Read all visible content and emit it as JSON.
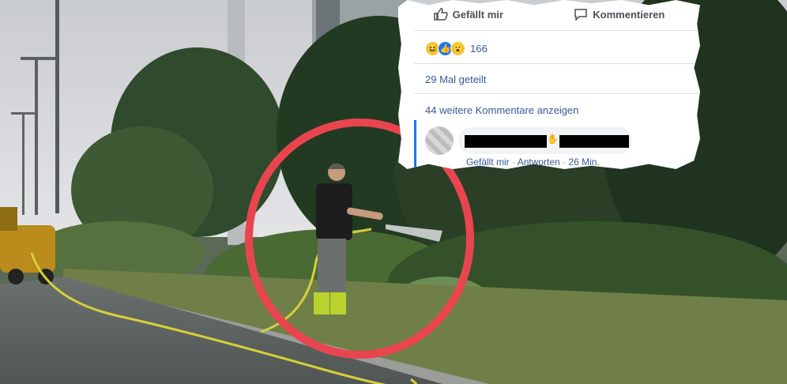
{
  "photo": {
    "description_icons": [
      "tree-icon",
      "lamp-post-icon",
      "hose-icon"
    ],
    "highlight_color": "#e8454f"
  },
  "fb_card": {
    "actions": {
      "like_label": "Gefällt mir",
      "comment_label": "Kommentieren"
    },
    "reactions": {
      "icons": [
        "haha-icon",
        "like-icon",
        "wow-icon"
      ],
      "count": "166"
    },
    "shares": "29 Mal geteilt",
    "more_comments": "44 weitere Kommentare anzeigen",
    "comment": {
      "like": "Gefällt mir",
      "sep1": "·",
      "reply": "Antworten",
      "sep2": "·",
      "time": "26 Min."
    }
  }
}
